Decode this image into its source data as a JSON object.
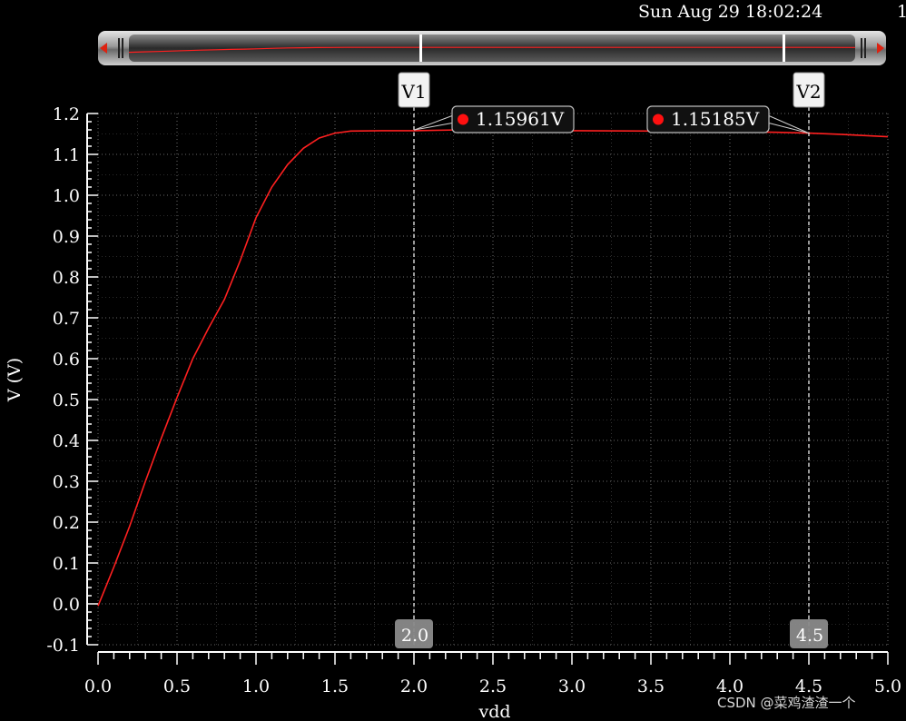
{
  "header": {
    "timestamp": "Sun Aug 29 18:02:24",
    "edge_text": "1"
  },
  "watermark": "CSDN @菜鸡渣渣一个",
  "colors": {
    "background": "#000000",
    "trace": "#ff2020",
    "grid": "#9a9a9a",
    "axis": "#ffffff",
    "marker_dot": "#ff1010"
  },
  "chart_data": {
    "type": "line",
    "xlabel": "vdd",
    "ylabel": "V (V)",
    "xlim": [
      0.0,
      5.0
    ],
    "ylim": [
      -0.1,
      1.2
    ],
    "xticks": [
      "0.0",
      "0.5",
      "1.0",
      "1.5",
      "2.0",
      "2.5",
      "3.0",
      "3.5",
      "4.0",
      "4.5",
      "5.0"
    ],
    "yticks": [
      "-0.1",
      "0.0",
      "0.1",
      "0.2",
      "0.3",
      "0.4",
      "0.5",
      "0.6",
      "0.7",
      "0.8",
      "0.9",
      "1.0",
      "1.1",
      "1.2"
    ],
    "grid": true,
    "series": [
      {
        "x": [
          0.0,
          0.1,
          0.2,
          0.3,
          0.4,
          0.5,
          0.6,
          0.7,
          0.8,
          0.9,
          1.0,
          1.1,
          1.2,
          1.3,
          1.4,
          1.5,
          1.6,
          1.8,
          2.0,
          2.3,
          2.6,
          3.0,
          3.5,
          4.0,
          4.3,
          4.5,
          4.7,
          5.0
        ],
        "y": [
          -0.005,
          0.09,
          0.19,
          0.3,
          0.405,
          0.505,
          0.6,
          0.675,
          0.745,
          0.84,
          0.945,
          1.02,
          1.075,
          1.115,
          1.14,
          1.152,
          1.157,
          1.158,
          1.158,
          1.16,
          1.159,
          1.158,
          1.157,
          1.156,
          1.154,
          1.152,
          1.149,
          1.143
        ]
      }
    ],
    "markers": [
      {
        "label": "V1",
        "x": 2.0,
        "x_label": "2.0"
      },
      {
        "label": "V2",
        "x": 4.5,
        "x_label": "4.5"
      }
    ],
    "annotations": [
      {
        "text": "1.15961V",
        "x": 2.0,
        "y": 1.15961
      },
      {
        "text": "1.15185V",
        "x": 4.5,
        "y": 1.15185
      }
    ]
  }
}
